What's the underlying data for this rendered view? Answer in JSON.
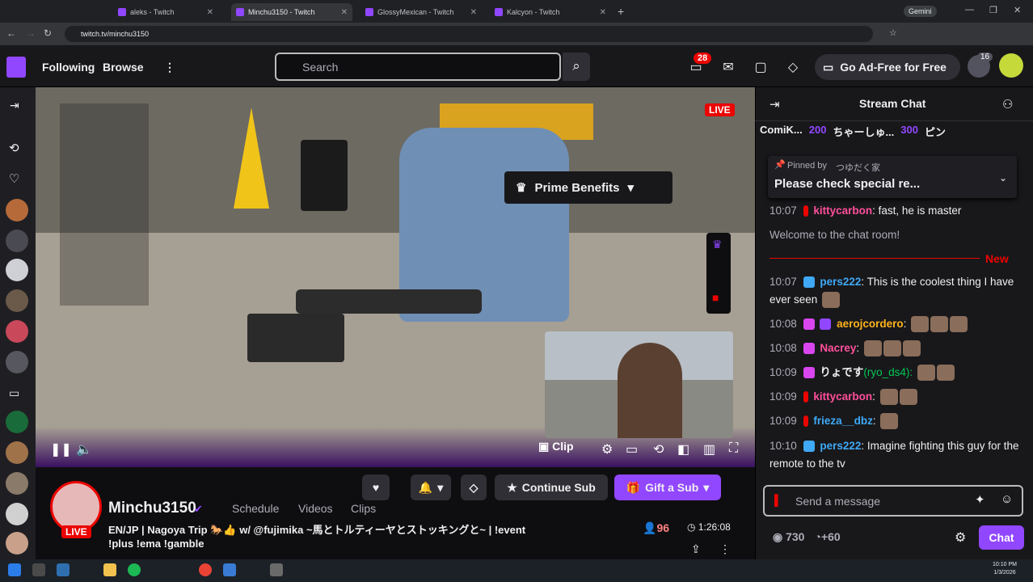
{
  "browser": {
    "tabs": [
      {
        "label": "aleks - Twitch"
      },
      {
        "label": "Minchu3150 - Twitch"
      },
      {
        "label": "GlossyMexican - Twitch"
      },
      {
        "label": "Kalcyon - Twitch"
      }
    ],
    "url": "twitch.tv/minchu3150",
    "gemini_label": "Gemini"
  },
  "nav": {
    "following": "Following",
    "browse": "Browse",
    "search_placeholder": "Search",
    "notifications_count": "28",
    "ad_free": "Go Ad-Free for Free",
    "avatar_badge": "16"
  },
  "video": {
    "live_label": "LIVE",
    "prime_benefits": "Prime Benefits",
    "clip_label": "Clip"
  },
  "channel": {
    "name": "Minchu3150",
    "live_tag": "LIVE",
    "links": [
      "Schedule",
      "Videos",
      "Clips"
    ],
    "title_line1": "EN/JP | Nagoya Trip 🐎👍 w/ @fujimika ~馬とトルティーヤとストッキングと~ | !event",
    "title_line2": "!plus !ema !gamble",
    "viewers": "96",
    "uptime": "1:26:08",
    "continue_sub": "Continue Sub",
    "gift_sub": "Gift a Sub"
  },
  "chat": {
    "title": "Stream Chat",
    "gifters": [
      {
        "name": "ComiK...",
        "amount": "200"
      },
      {
        "name": "ちゃーしゅ...",
        "amount": "300"
      },
      {
        "name": "ピン",
        "amount": ""
      }
    ],
    "pinned_by": "Pinned by",
    "pinned_user": "つゆだく家",
    "pinned_text": "Please check special re...",
    "messages": [
      {
        "time": "10:07",
        "user": "kittycarbon",
        "text": ": fast, he is master",
        "color": "#ff4f9a"
      },
      {
        "time": "",
        "user": "",
        "text": "Welcome to the chat room!",
        "color": "#adadb8"
      },
      {
        "time": "10:07",
        "user": "pers222",
        "text": ": This is the coolest thing I have ever seen",
        "color": "#3fa9f5"
      },
      {
        "time": "10:08",
        "user": "aerojcordero",
        "text": ":",
        "color": "#ffb31a"
      },
      {
        "time": "10:08",
        "user": "Nacrey",
        "text": ":",
        "color": "#ff4f9a"
      },
      {
        "time": "10:09",
        "user": "りょです",
        "text": "(ryo_ds4):",
        "color": "#efeff1"
      },
      {
        "time": "10:09",
        "user": "kittycarbon",
        "text": ":",
        "color": "#ff4f9a"
      },
      {
        "time": "10:09",
        "user": "frieza__dbz",
        "text": ":",
        "color": "#3fa9f5"
      },
      {
        "time": "10:10",
        "user": "pers222",
        "text": ": Imagine fighting this guy for the remote to the tv",
        "color": "#3fa9f5"
      }
    ],
    "new_label": "New",
    "input_placeholder": "Send a message",
    "points": "730",
    "points_bonus": "+60",
    "chat_button": "Chat"
  },
  "taskbar": {
    "time": "10:10 PM",
    "date": "1/3/2026"
  },
  "colors": {
    "twitch_purple": "#9147ff",
    "live_red": "#eb0400"
  }
}
